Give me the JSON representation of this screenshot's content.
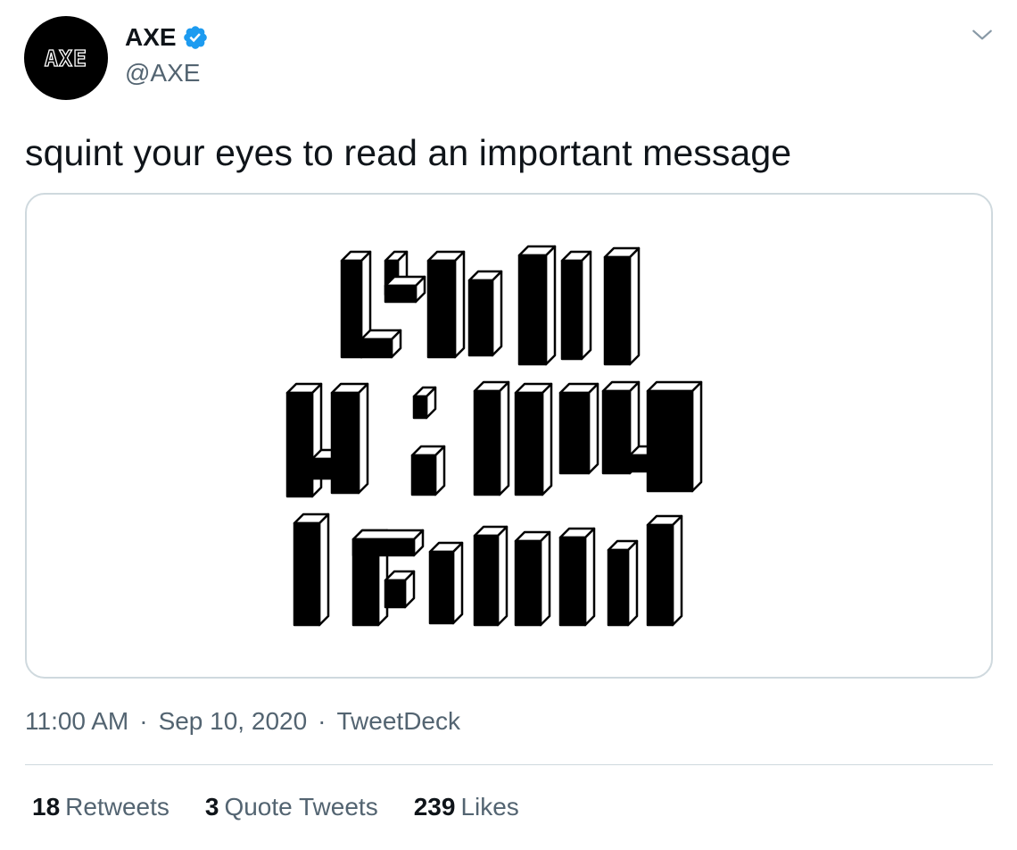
{
  "author": {
    "display_name": "AXE",
    "handle": "@AXE",
    "avatar_logo": "AXE",
    "verified": true,
    "verified_color": "#1d9bf0"
  },
  "tweet": {
    "text": "squint your eyes to read an important message",
    "time": "11:00 AM",
    "date": "Sep 10, 2020",
    "separator": "·",
    "source": "TweetDeck"
  },
  "stats": {
    "retweets_count": "18",
    "retweets_label": "Retweets",
    "quotes_count": "3",
    "quotes_label": "Quote Tweets",
    "likes_count": "239",
    "likes_label": "Likes"
  },
  "icons": {
    "more": "chevron-down-icon",
    "verified": "verified-badge-icon"
  }
}
